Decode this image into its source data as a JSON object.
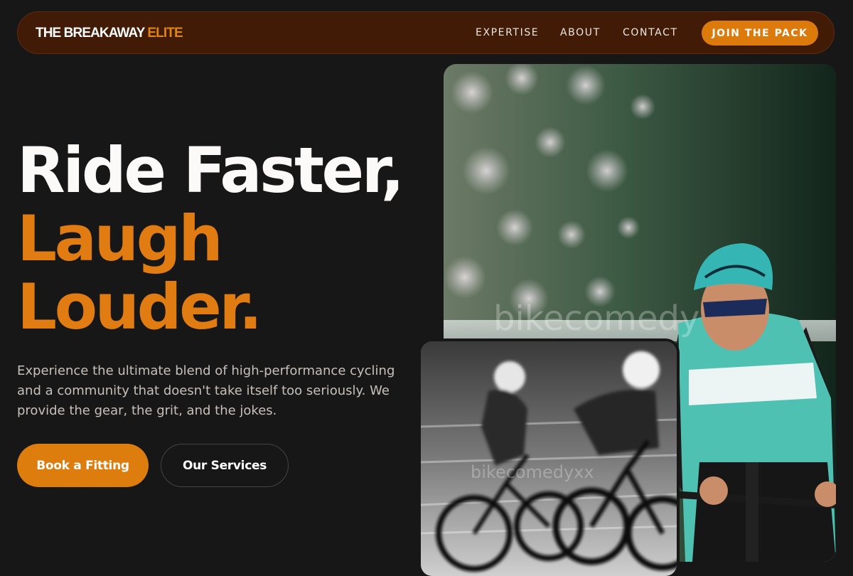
{
  "brand": {
    "name_main": "THE BREAKAWAY",
    "name_accent": "ELITE"
  },
  "nav": {
    "links": [
      "EXPERTISE",
      "ABOUT",
      "CONTACT"
    ],
    "cta": "JOIN THE PACK"
  },
  "hero": {
    "headline_line1": "Ride Faster,",
    "headline_line2": "Laugh",
    "headline_line3": "Louder.",
    "lead": "Experience the ultimate blend of high-performance cycling and a community that doesn't take itself too seriously. We provide the gear, the grit, and the jokes.",
    "primary_button": "Book a Fitting",
    "secondary_button": "Our Services"
  },
  "images": {
    "main_watermark": "bikecomedy",
    "secondary_watermark": "bikecomedyxx"
  },
  "colors": {
    "accent": "#dd7d0e",
    "background": "#181717",
    "nav_background": "#421b07"
  }
}
